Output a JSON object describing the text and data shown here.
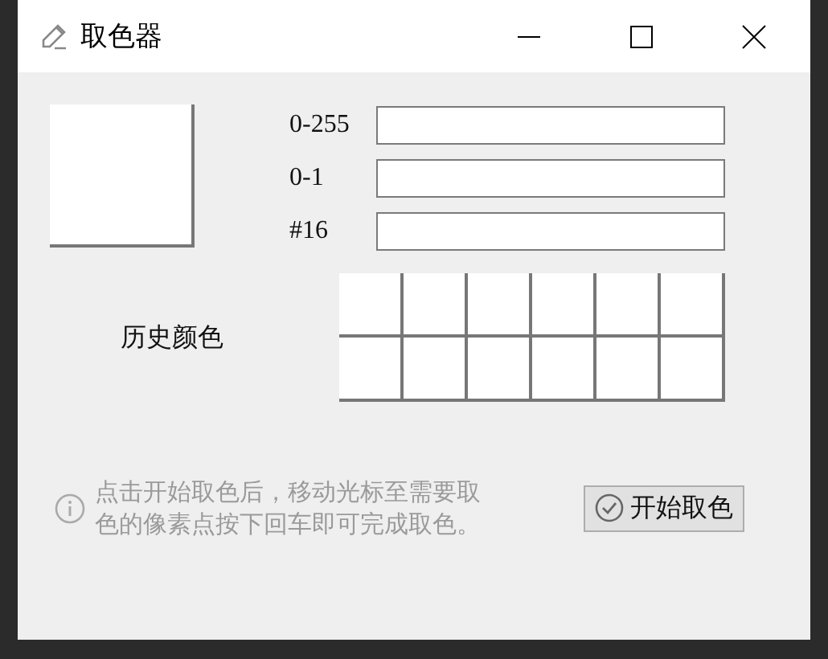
{
  "window": {
    "title": "取色器"
  },
  "preview": {
    "color": "#ffffff"
  },
  "fields": [
    {
      "label": "0-255"
    },
    {
      "label": "0-1"
    },
    {
      "label": "#16"
    }
  ],
  "history": {
    "label": "历史颜色",
    "swatches": [
      {
        "color": "#ffffff"
      },
      {
        "color": "#ffffff"
      },
      {
        "color": "#ffffff"
      },
      {
        "color": "#ffffff"
      },
      {
        "color": "#ffffff"
      },
      {
        "color": "#ffffff"
      },
      {
        "color": "#ffffff"
      },
      {
        "color": "#ffffff"
      },
      {
        "color": "#ffffff"
      },
      {
        "color": "#ffffff"
      },
      {
        "color": "#ffffff"
      },
      {
        "color": "#ffffff"
      }
    ]
  },
  "hint": {
    "lines": [
      "点击开始取色后，移动光标至需要取",
      "色的像素点按下回车即可完成取色。"
    ]
  },
  "start_button": {
    "label": "开始取色"
  }
}
